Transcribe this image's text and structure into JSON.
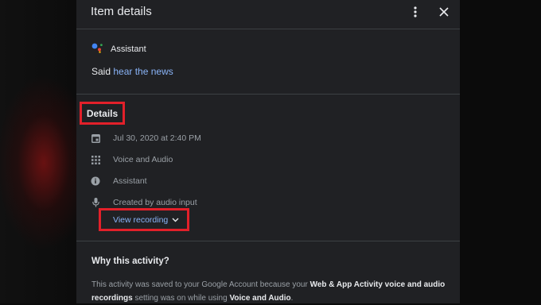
{
  "header": {
    "title": "Item details",
    "more_icon": "more-vert-icon",
    "close_icon": "close-icon"
  },
  "product": {
    "name": "Assistant",
    "icon": "google-assistant-icon"
  },
  "said": {
    "prefix": "Said",
    "link_text": "hear the news"
  },
  "details": {
    "heading": "Details",
    "rows": [
      {
        "icon": "calendar-icon",
        "text": "Jul 30, 2020 at 2:40 PM"
      },
      {
        "icon": "apps-grid-icon",
        "text": "Voice and Audio"
      },
      {
        "icon": "info-icon",
        "text": "Assistant"
      },
      {
        "icon": "mic-icon",
        "text": "Created by audio input"
      }
    ],
    "view_recording": "View recording"
  },
  "why": {
    "heading": "Why this activity?",
    "text_1": "This activity was saved to your Google Account because your",
    "bold_1": "Web & App Activity voice and audio recordings",
    "text_2": "setting was on while using",
    "bold_2": "Voice and Audio",
    "text_3": "."
  },
  "colors": {
    "panel": "#202124",
    "link": "#8ab4f8",
    "highlight": "#e2202a"
  }
}
